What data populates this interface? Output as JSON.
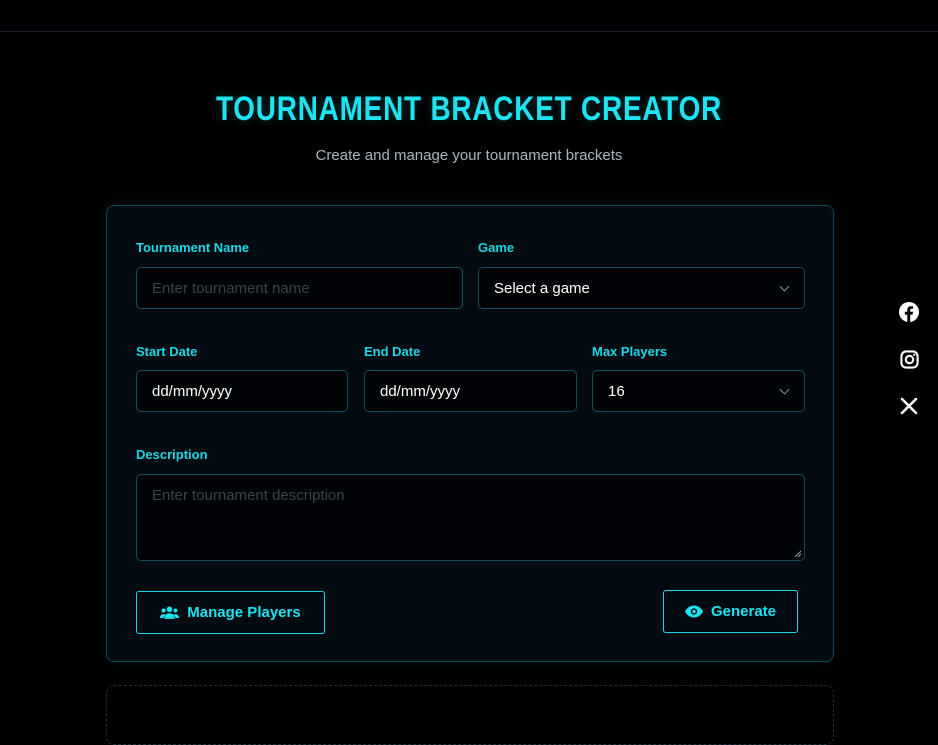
{
  "header": {
    "title": "TOURNAMENT BRACKET CREATOR",
    "subtitle": "Create and manage your tournament brackets"
  },
  "form": {
    "tournament_name": {
      "label": "Tournament Name",
      "placeholder": "Enter tournament name",
      "value": ""
    },
    "game": {
      "label": "Game",
      "value": "Select a game"
    },
    "start_date": {
      "label": "Start Date",
      "value": "dd/mm/yyyy"
    },
    "end_date": {
      "label": "End Date",
      "value": "dd/mm/yyyy"
    },
    "max_players": {
      "label": "Max Players",
      "value": "16"
    },
    "description": {
      "label": "Description",
      "placeholder": "Enter tournament description",
      "value": ""
    }
  },
  "actions": {
    "manage_players": "Manage Players",
    "generate": "Generate"
  },
  "social": {
    "icons": [
      "facebook-icon",
      "instagram-icon",
      "x-icon"
    ]
  },
  "colors": {
    "accent": "#1fe2ef",
    "background": "#000000",
    "card": "#020a12",
    "border": "#0f4e5c"
  }
}
